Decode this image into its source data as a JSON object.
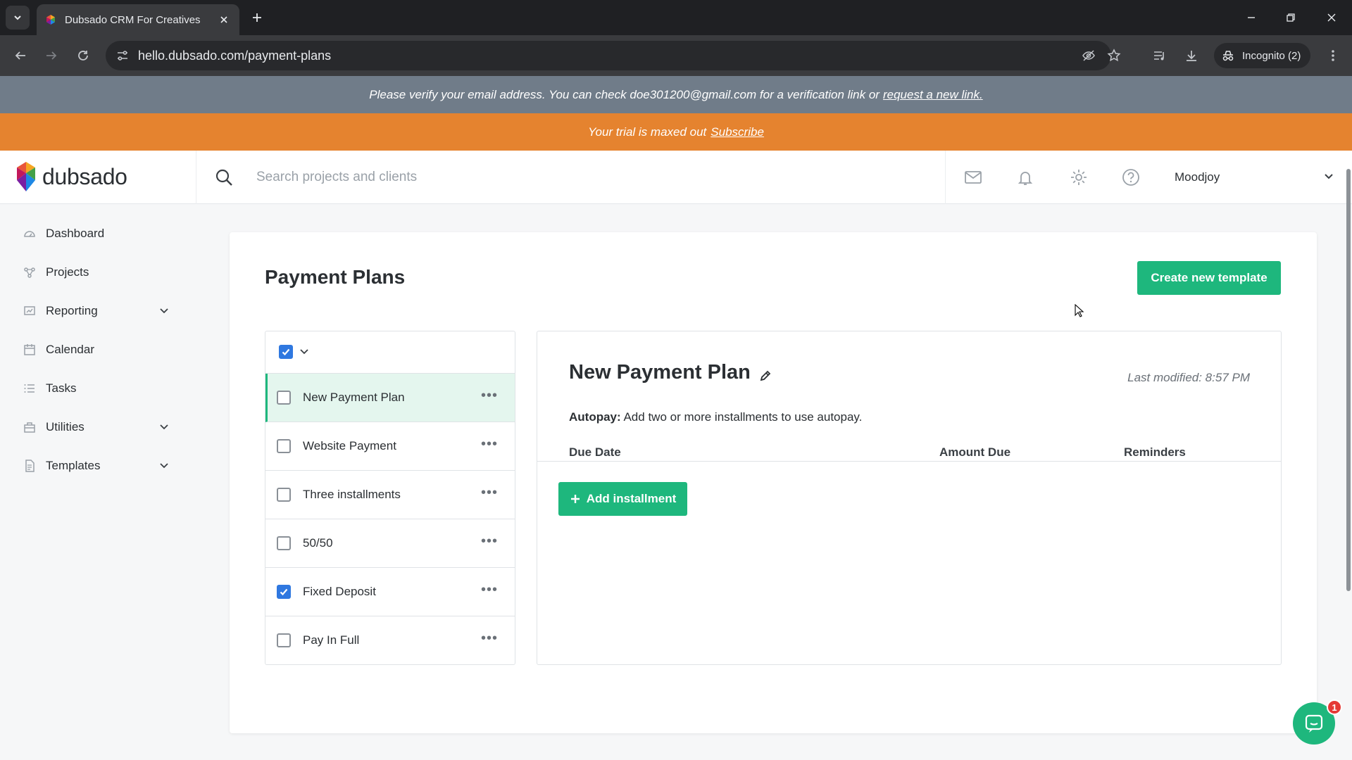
{
  "browser": {
    "tab_title": "Dubsado CRM For Creatives",
    "url": "hello.dubsado.com/payment-plans",
    "incognito_label": "Incognito (2)"
  },
  "banners": {
    "verify_text": "Please verify your email address. You can check doe301200@gmail.com for a verification link or",
    "verify_link": "request a new link.",
    "trial_text": "Your trial is maxed out",
    "trial_link": "Subscribe"
  },
  "header": {
    "logo_text": "dubsado",
    "search_placeholder": "Search projects and clients",
    "user_name": "Moodjoy"
  },
  "sidebar": {
    "items": [
      {
        "label": "Dashboard",
        "icon": "dashboard-icon",
        "expandable": false
      },
      {
        "label": "Projects",
        "icon": "projects-icon",
        "expandable": false
      },
      {
        "label": "Reporting",
        "icon": "reporting-icon",
        "expandable": true
      },
      {
        "label": "Calendar",
        "icon": "calendar-icon",
        "expandable": false
      },
      {
        "label": "Tasks",
        "icon": "tasks-icon",
        "expandable": false
      },
      {
        "label": "Utilities",
        "icon": "utilities-icon",
        "expandable": true
      },
      {
        "label": "Templates",
        "icon": "templates-icon",
        "expandable": true
      }
    ]
  },
  "main": {
    "title": "Payment Plans",
    "create_button": "Create new template",
    "plans": [
      {
        "name": "New Payment Plan",
        "checked": false,
        "active": true
      },
      {
        "name": "Website Payment",
        "checked": false,
        "active": false
      },
      {
        "name": "Three installments",
        "checked": false,
        "active": false
      },
      {
        "name": "50/50",
        "checked": false,
        "active": false
      },
      {
        "name": "Fixed Deposit",
        "checked": true,
        "active": false
      },
      {
        "name": "Pay In Full",
        "checked": false,
        "active": false
      }
    ],
    "detail": {
      "title": "New Payment Plan",
      "last_modified": "Last modified: 8:57 PM",
      "autopay_label": "Autopay:",
      "autopay_text": "Add two or more installments to use autopay.",
      "columns": [
        "Due Date",
        "Amount Due",
        "Reminders"
      ],
      "add_button": "Add installment"
    }
  },
  "chat": {
    "badge_count": "1"
  },
  "colors": {
    "accent": "#1eb77d",
    "trial_banner": "#e5832f",
    "verify_banner": "#707c89",
    "checkbox": "#2f78e0"
  }
}
